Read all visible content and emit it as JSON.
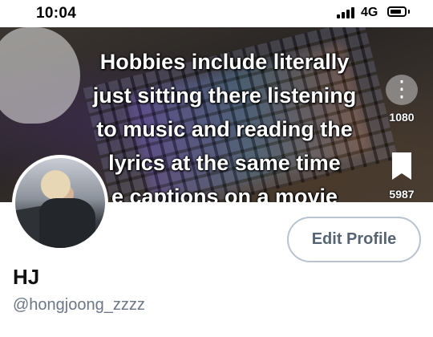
{
  "status_bar": {
    "time": "10:04",
    "network": "4G",
    "signal_bars": 4,
    "battery_icon": "battery-icon"
  },
  "banner": {
    "caption_lines": [
      "Hobbies include literally",
      "just sitting there listening",
      "to music and reading the",
      "lyrics at the same time",
      "e captions on a movie"
    ],
    "side_actions": [
      {
        "icon": "reel-icon",
        "count": "1080"
      },
      {
        "icon": "bookmark-icon",
        "count": "5987"
      }
    ]
  },
  "profile": {
    "avatar_icon": "avatar",
    "edit_button_label": "Edit Profile",
    "display_name": "HJ",
    "handle": "@hongjoong_zzzz"
  },
  "colors": {
    "edit_button_border": "#b8c3cf",
    "edit_button_text": "#566473",
    "handle_text": "#6b7785"
  }
}
